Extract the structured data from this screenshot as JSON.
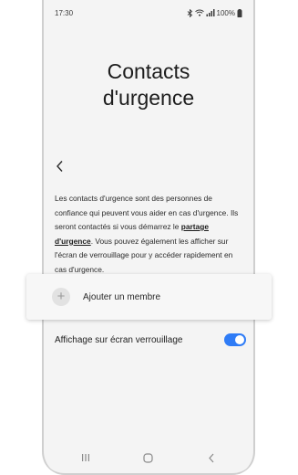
{
  "status_bar": {
    "time": "17:30",
    "battery": "100%"
  },
  "header": {
    "title_line1": "Contacts",
    "title_line2": "d'urgence"
  },
  "description": {
    "text_before_link": "Les contacts d'urgence sont des personnes de confiance qui peuvent vous aider en cas d'urgence. Ils seront contactés si vous démarrez le ",
    "link_text": "partage d'urgence",
    "text_after_link": ". Vous pouvez également les afficher sur l'écran de verrouillage pour y accéder rapidement en cas d'urgence."
  },
  "add_member": {
    "label": "Ajouter un membre"
  },
  "lock_screen_setting": {
    "label": "Affichage sur écran verrouillage",
    "enabled": true
  },
  "colors": {
    "toggle_on": "#2f7cf6",
    "screen_background": "#f4f4f4"
  },
  "icons": {
    "back": "chevron-left-icon",
    "add": "plus-icon",
    "nav_recent": "recent-apps-icon",
    "nav_home": "home-icon",
    "nav_back": "back-icon"
  }
}
